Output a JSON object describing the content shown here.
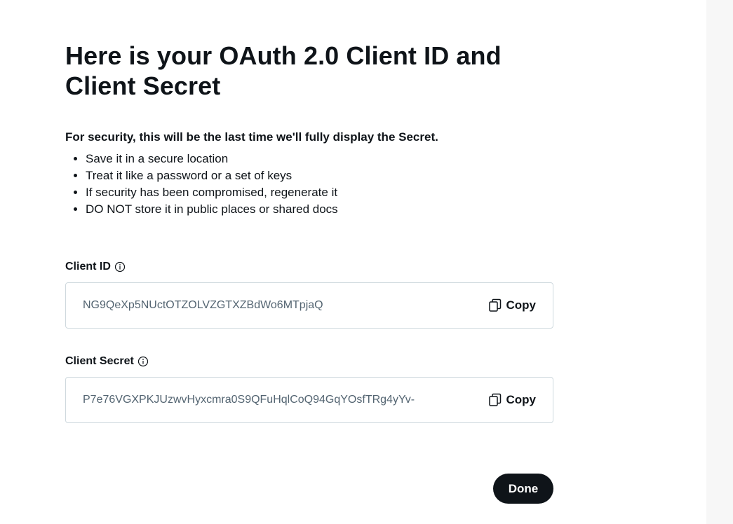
{
  "dialog": {
    "title": "Here is your OAuth 2.0 Client ID and Client Secret",
    "security_heading": "For security, this will be the last time we'll fully display the Secret.",
    "tips": [
      "Save it in a secure location",
      "Treat it like a password or a set of keys",
      "If security has been compromised, regenerate it",
      "DO NOT store it in public places or shared docs"
    ]
  },
  "client_id": {
    "label": "Client ID",
    "value": "NG9QeXp5NUctOTZOLVZGTXZBdWo6MTpjaQ",
    "copy_label": "Copy"
  },
  "client_secret": {
    "label": "Client Secret",
    "value": "P7e76VGXPKJUzwvHyxcmra0S9QFuHqlCoQ94GqYOsfTRg4yYv-",
    "copy_label": "Copy"
  },
  "actions": {
    "done_label": "Done"
  },
  "icons": {
    "info": "info-circle-icon",
    "copy": "copy-icon"
  }
}
